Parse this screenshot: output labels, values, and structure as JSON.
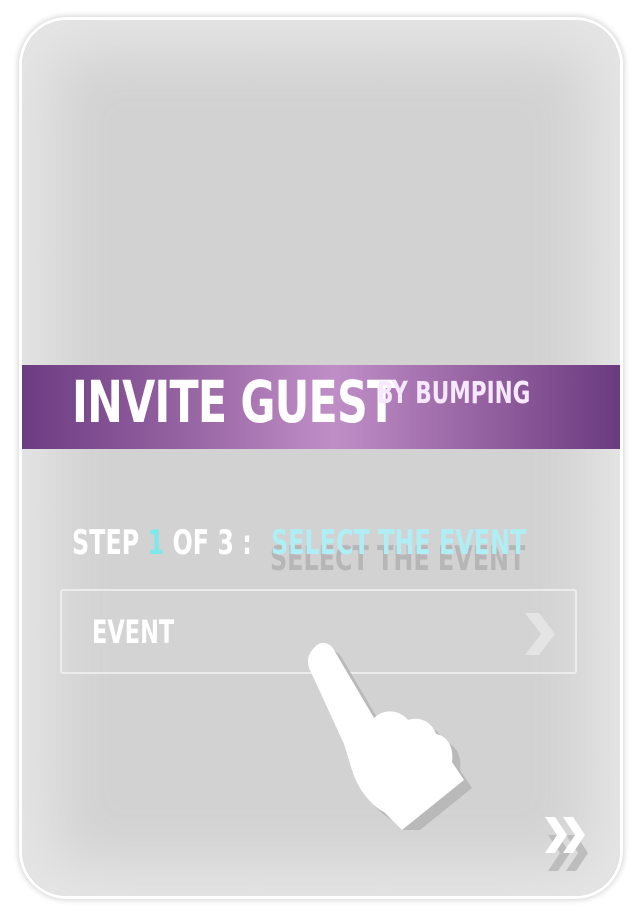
{
  "banner": {
    "title": "INVITE GUEST",
    "subtitle": "BY BUMPING",
    "gradient_colors": [
      "#6c3c83",
      "#c08ec7",
      "#6a3b80"
    ]
  },
  "step": {
    "prefix": "STEP",
    "current": "1",
    "of_text": "OF 3 :",
    "instruction": "SELECT THE EVENT",
    "current_color": "#7fe8ee"
  },
  "event_field": {
    "label": "EVENT",
    "icon": "chevron-right-icon"
  },
  "gesture": {
    "icon": "pointing-hand-icon"
  },
  "navigation": {
    "icon": "double-chevron-right-icon"
  }
}
